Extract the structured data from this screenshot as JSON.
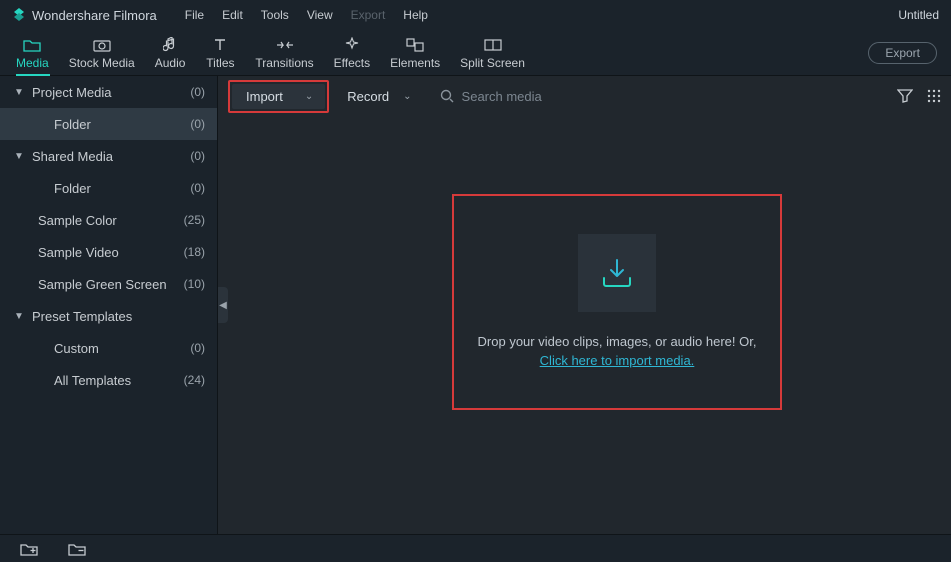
{
  "app_title": "Wondershare Filmora",
  "project_title": "Untitled",
  "menubar": {
    "file": "File",
    "edit": "Edit",
    "tools": "Tools",
    "view": "View",
    "export": "Export",
    "help": "Help"
  },
  "toolbar": {
    "media": "Media",
    "stock_media": "Stock Media",
    "audio": "Audio",
    "titles": "Titles",
    "transitions": "Transitions",
    "effects": "Effects",
    "elements": "Elements",
    "split_screen": "Split Screen",
    "export_btn": "Export"
  },
  "sidebar": {
    "project_media": {
      "label": "Project Media",
      "count": "(0)"
    },
    "project_folder": {
      "label": "Folder",
      "count": "(0)"
    },
    "shared_media": {
      "label": "Shared Media",
      "count": "(0)"
    },
    "shared_folder": {
      "label": "Folder",
      "count": "(0)"
    },
    "sample_color": {
      "label": "Sample Color",
      "count": "(25)"
    },
    "sample_video": {
      "label": "Sample Video",
      "count": "(18)"
    },
    "sample_green": {
      "label": "Sample Green Screen",
      "count": "(10)"
    },
    "preset_templates": {
      "label": "Preset Templates",
      "count": ""
    },
    "custom": {
      "label": "Custom",
      "count": "(0)"
    },
    "all_templates": {
      "label": "All Templates",
      "count": "(24)"
    }
  },
  "canvas": {
    "import_btn": "Import",
    "record_btn": "Record",
    "search_placeholder": "Search media",
    "drop_line": "Drop your video clips, images, or audio here! Or,",
    "import_link": "Click here to import media."
  }
}
